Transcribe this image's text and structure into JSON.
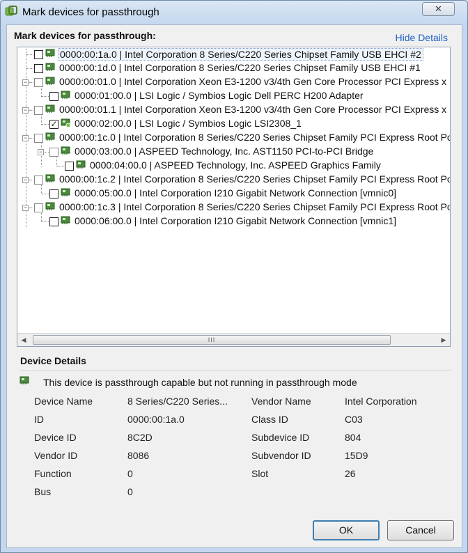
{
  "window": {
    "title": "Mark devices for passthrough",
    "close_glyph": "✕"
  },
  "header": {
    "label": "Mark devices for passthrough:",
    "hide_details": "Hide Details"
  },
  "tree": [
    {
      "text": "0000:00:1a.0 | Intel Corporation 8 Series/C220 Series Chipset Family USB EHCI #2",
      "checked": false,
      "selected": true
    },
    {
      "text": "0000:00:1d.0 | Intel Corporation 8 Series/C220 Series Chipset Family USB EHCI #1",
      "checked": false
    },
    {
      "text": "0000:00:01.0 | Intel Corporation Xeon E3-1200 v3/4th Gen Core Processor PCI Express x",
      "checked": false
    },
    {
      "text": "0000:01:00.0 | LSI Logic / Symbios Logic Dell PERC H200 Adapter",
      "checked": false
    },
    {
      "text": "0000:00:01.1 | Intel Corporation Xeon E3-1200 v3/4th Gen Core Processor PCI Express x",
      "checked": false
    },
    {
      "text": "0000:02:00.0 | LSI Logic / Symbios Logic LSI2308_1",
      "checked": true
    },
    {
      "text": "0000:00:1c.0 | Intel Corporation 8 Series/C220 Series Chipset Family PCI Express Root Po",
      "checked": false
    },
    {
      "text": "0000:03:00.0 | ASPEED Technology, Inc. AST1150 PCI-to-PCI Bridge",
      "checked": false
    },
    {
      "text": "0000:04:00.0 | ASPEED Technology, Inc. ASPEED Graphics Family",
      "checked": false
    },
    {
      "text": "0000:00:1c.2 | Intel Corporation 8 Series/C220 Series Chipset Family PCI Express Root Po",
      "checked": false
    },
    {
      "text": "0000:05:00.0 | Intel Corporation I210 Gigabit Network Connection [vmnic0]",
      "checked": false
    },
    {
      "text": "0000:00:1c.3 | Intel Corporation 8 Series/C220 Series Chipset Family PCI Express Root Po",
      "checked": false
    },
    {
      "text": "0000:06:00.0 | Intel Corporation I210 Gigabit Network Connection [vmnic1]",
      "checked": false
    }
  ],
  "scroll": {
    "grip": "III",
    "left_arrow": "◀",
    "right_arrow": "▶"
  },
  "details": {
    "title": "Device Details",
    "status": "This device is passthrough capable but not running in passthrough mode",
    "fields": {
      "device_name_label": "Device Name",
      "device_name": "8 Series/C220 Series...",
      "vendor_name_label": "Vendor Name",
      "vendor_name": "Intel Corporation",
      "id_label": "ID",
      "id": "0000:00:1a.0",
      "class_id_label": "Class ID",
      "class_id": "C03",
      "device_id_label": "Device ID",
      "device_id": "8C2D",
      "subdevice_id_label": "Subdevice ID",
      "subdevice_id": "804",
      "vendor_id_label": "Vendor ID",
      "vendor_id": "8086",
      "subvendor_id_label": "Subvendor ID",
      "subvendor_id": "15D9",
      "function_label": "Function",
      "function": "0",
      "slot_label": "Slot",
      "slot": "26",
      "bus_label": "Bus",
      "bus": "0"
    }
  },
  "buttons": {
    "ok": "OK",
    "cancel": "Cancel"
  },
  "colors": {
    "link": "#1d62c6",
    "device_icon": "#4a8a3c",
    "default_button_border": "#3c7fb1"
  }
}
